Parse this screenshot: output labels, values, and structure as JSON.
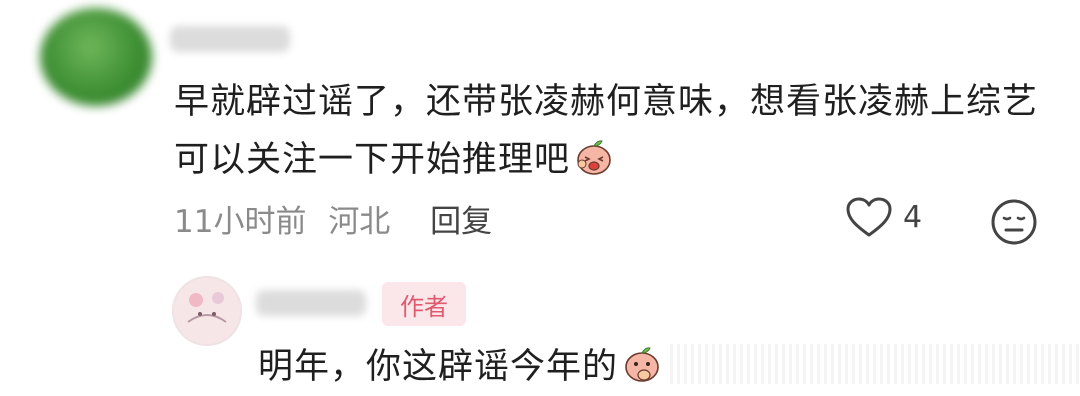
{
  "comment": {
    "text": "早就辟过谣了，还带张凌赫何意味，想看张凌赫上综艺可以关注一下开始推理吧",
    "emoji": "laughing-peach-emoji",
    "time": "11小时前",
    "location": "河北",
    "reply_label": "回复",
    "like_count": "4"
  },
  "reply": {
    "badge": "作者",
    "text": "明年，你这辟谣今年的",
    "emoji": "covering-mouth-peach-emoji"
  },
  "colors": {
    "badge_bg": "#fbe7ea",
    "badge_text": "#e05a6f",
    "meta_text": "#8a8a8a"
  }
}
